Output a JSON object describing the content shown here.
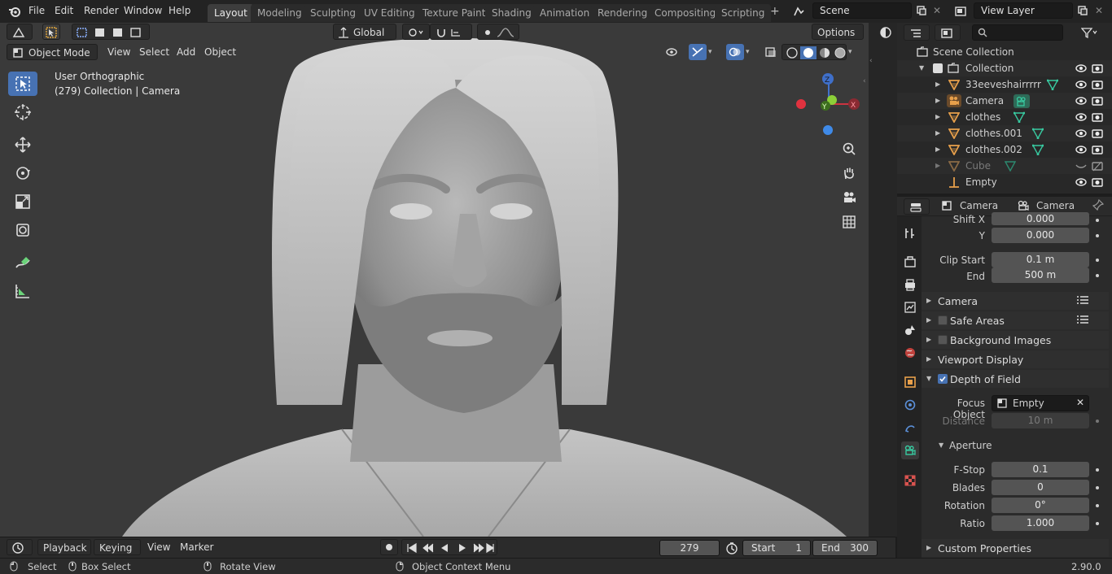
{
  "menu": [
    "File",
    "Edit",
    "Render",
    "Window",
    "Help"
  ],
  "workspaces": [
    "Layout",
    "Modeling",
    "Sculpting",
    "UV Editing",
    "Texture Paint",
    "Shading",
    "Animation",
    "Rendering",
    "Compositing",
    "Scripting"
  ],
  "active_workspace": "Layout",
  "scene": {
    "label": "Scene",
    "view_layer": "View Layer"
  },
  "viewport": {
    "mode": "Object Mode",
    "menus": [
      "View",
      "Select",
      "Add",
      "Object"
    ],
    "orientation": "Global",
    "options": "Options",
    "overlay_line1": "User Orthographic",
    "overlay_line2": "(279) Collection | Camera",
    "gizmo": {
      "z": "Z",
      "y": "Y",
      "x": "X"
    }
  },
  "outliner": {
    "root": "Scene Collection",
    "items": [
      {
        "name": "Collection",
        "type": "collection"
      },
      {
        "name": "33eeveshairrrrr",
        "type": "mesh"
      },
      {
        "name": "Camera",
        "type": "camera"
      },
      {
        "name": "clothes",
        "type": "mesh"
      },
      {
        "name": "clothes.001",
        "type": "mesh"
      },
      {
        "name": "clothes.002",
        "type": "mesh"
      },
      {
        "name": "Cube",
        "type": "mesh",
        "dim": true
      },
      {
        "name": "Empty",
        "type": "empty"
      }
    ]
  },
  "properties": {
    "header_object": "Camera",
    "header_data": "Camera",
    "shift_x_label": "Shift X",
    "shift_x": "0.000",
    "shift_y_label": "Y",
    "shift_y": "0.000",
    "clip_start_label": "Clip Start",
    "clip_start": "0.1 m",
    "clip_end_label": "End",
    "clip_end": "500 m",
    "panels": {
      "camera": "Camera",
      "safe_areas": "Safe Areas",
      "background_images": "Background Images",
      "viewport_display": "Viewport Display",
      "dof": "Depth of Field",
      "aperture": "Aperture",
      "custom": "Custom Properties"
    },
    "focus_object_label": "Focus Object",
    "focus_object": "Empty",
    "distance_label": "Distance",
    "distance": "10 m",
    "fstop_label": "F-Stop",
    "fstop": "0.1",
    "blades_label": "Blades",
    "blades": "0",
    "rotation_label": "Rotation",
    "rotation": "0°",
    "ratio_label": "Ratio",
    "ratio": "1.000"
  },
  "timeline": {
    "menus": [
      "Playback",
      "Keying",
      "View",
      "Marker"
    ],
    "current_frame": "279",
    "start_label": "Start",
    "start": "1",
    "end_label": "End",
    "end": "300"
  },
  "status": {
    "select": "Select",
    "box_select": "Box Select",
    "rotate_view": "Rotate View",
    "context_menu": "Object Context Menu",
    "version": "2.90.0"
  },
  "colors": {
    "accent": "#4772b3",
    "mesh_icon": "#e8a04b",
    "data_icon": "#38c9a0"
  }
}
